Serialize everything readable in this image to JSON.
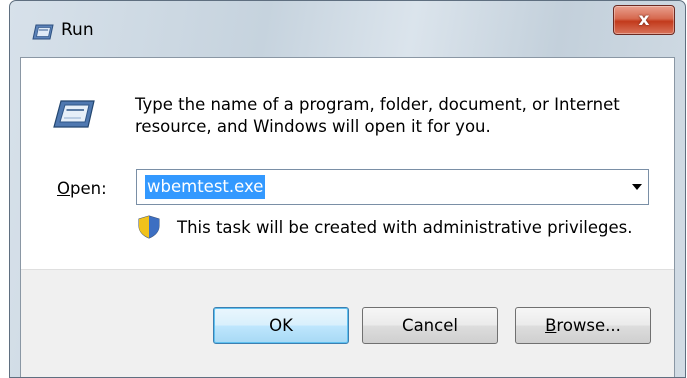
{
  "window": {
    "title": "Run",
    "close_label": "x"
  },
  "dialog": {
    "description": "Type the name of a program, folder, document, or Internet resource, and Windows will open it for you.",
    "open_label_mnemonic": "O",
    "open_label_rest": "pen:",
    "open_value": "wbemtest.exe",
    "admin_note": "This task will be created with administrative privileges."
  },
  "buttons": {
    "ok": "OK",
    "cancel": "Cancel",
    "browse_mnemonic": "B",
    "browse_rest": "rowse..."
  },
  "colors": {
    "selection": "#3399ff",
    "close_button": "#c23a1c",
    "default_button_border": "#3c7fb1"
  },
  "icons": [
    "run-icon",
    "shield-icon",
    "close-icon",
    "chevron-down-icon"
  ]
}
